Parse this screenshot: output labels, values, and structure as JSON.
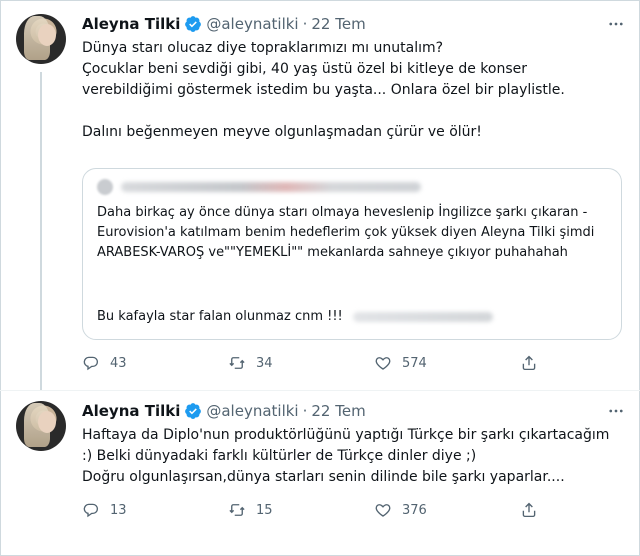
{
  "tweets": [
    {
      "author_name": "Aleyna Tilki",
      "handle": "@aleynatilki",
      "separator": "·",
      "date": "22 Tem",
      "text": "Dünya starı olucaz diye topraklarımızı mı unutalım?\nÇocuklar beni sevdiği gibi, 40 yaş üstü özel bi kitleye de  konser verebildiğimi göstermek istedim bu yaşta... Onlara özel bir playlistle.\n\nDalını beğenmeyen meyve olgunlaşmadan çürür ve ölür!",
      "quoted": {
        "text": "Daha birkaç ay önce dünya starı olmaya heveslenip İngilizce şarkı çıkaran - Eurovision'a katılmam benim hedeflerim çok yüksek diyen Aleyna Tilki şimdi ARABESK-VAROŞ ve\"\"YEMEKLİ\"\" mekanlarda sahneye çıkıyor puhahahah",
        "last_line": "Bu kafayla star falan olunmaz cnm !!!"
      },
      "replies": "43",
      "retweets": "34",
      "likes": "574"
    },
    {
      "author_name": "Aleyna Tilki",
      "handle": "@aleynatilki",
      "separator": "·",
      "date": "22 Tem",
      "text": "Haftaya da Diplo'nun produktörlüğünü yaptığı Türkçe bir şarkı çıkartacağım :) Belki dünyadaki farklı kültürler de Türkçe dinler diye ;)\nDoğru olgunlaşırsan,dünya starları senin dilinde bile şarkı yaparlar....",
      "replies": "13",
      "retweets": "15",
      "likes": "376"
    }
  ],
  "icons": {
    "verified": "verified-badge-icon",
    "more": "more-options-icon",
    "reply": "reply-icon",
    "retweet": "retweet-icon",
    "like": "heart-icon",
    "share": "share-icon"
  },
  "colors": {
    "verified_blue": "#1d9bf0",
    "text_primary": "#0f1419",
    "text_secondary": "#536471",
    "border": "#cfd9de"
  }
}
